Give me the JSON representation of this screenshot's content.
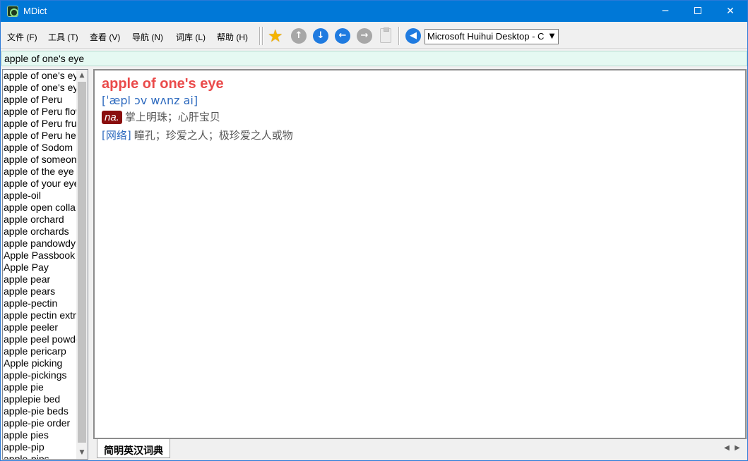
{
  "window": {
    "title": "MDict"
  },
  "menu": [
    "文件 (F)",
    "工具 (T)",
    "查看 (V)",
    "导航 (N)",
    "词库 (L)",
    "帮助 (H)"
  ],
  "toolbar": {
    "font_select_value": "Microsoft Huihui Desktop - C"
  },
  "search": {
    "value": "apple of one's eye"
  },
  "word_list": [
    "apple of one's eye",
    "apple of one's eyes",
    "apple of Peru",
    "apple of Peru flower",
    "apple of Peru fruit",
    "apple of Peru herb",
    "apple of Sodom",
    "apple of someone's eye",
    "apple of the eye",
    "apple of your eye",
    "apple-oil",
    "apple open collar",
    "apple orchard",
    "apple orchards",
    "apple pandowdy",
    "Apple Passbook",
    "Apple Pay",
    "apple pear",
    "apple pears",
    "apple-pectin",
    "apple pectin extract",
    "apple peeler",
    "apple peel powder",
    "apple pericarp",
    "Apple picking",
    "apple-pickings",
    "apple pie",
    "applepie bed",
    "apple-pie beds",
    "apple-pie order",
    "apple pies",
    "apple-pip",
    "apple-pips"
  ],
  "entry": {
    "headword": "apple of one's eye",
    "phonetic": "[ˈæpl ɔv wʌnz ai]",
    "pos": "na.",
    "definition": "掌上明珠；心肝宝贝",
    "web_tag": "[网络]",
    "web_definition": "瞳孔；珍爱之人；极珍爱之人或物"
  },
  "tabs": {
    "active": "简明英汉词典"
  }
}
